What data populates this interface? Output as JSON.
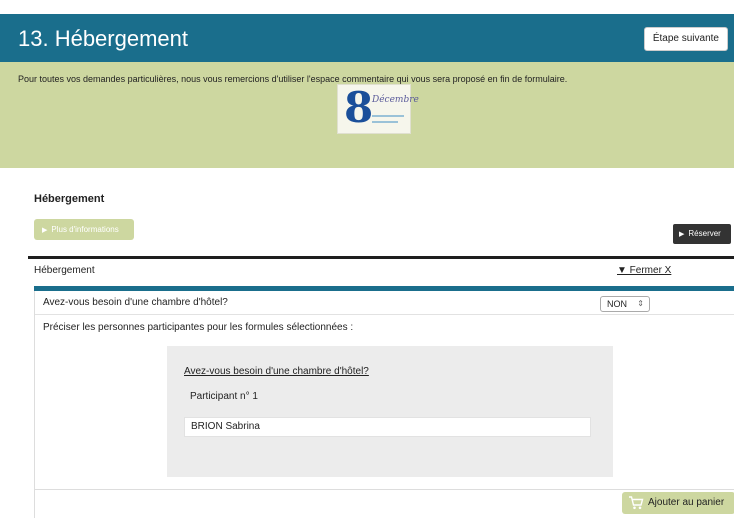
{
  "header": {
    "title": "13. Hébergement",
    "next_step_label": "Étape suivante"
  },
  "banner": {
    "text": "Pour toutes vos demandes particulières, nous vous remercions d'utiliser l'espace commentaire qui vous sera proposé en fin de formulaire.",
    "logo_digit": "8",
    "logo_script": "Décembre"
  },
  "section": {
    "heading": "Hébergement",
    "more_info_label": "Plus d'informations",
    "reserve_label": "Réserver"
  },
  "panel": {
    "title": "Hébergement",
    "close_label": "▼ Fermer  X",
    "question": "Avez-vous besoin d'une chambre d'hôtel?",
    "select_value": "NON",
    "participants_prompt": "Préciser les personnes participantes pour les formules sélectionnées :",
    "card": {
      "question": "Avez-vous besoin d'une chambre d'hôtel?",
      "participant_label": "Participant n° 1",
      "participant_name": "BRION Sabrina"
    },
    "cart_label": "Ajouter au panier"
  },
  "colors": {
    "header_bg": "#1a6e8c",
    "banner_bg": "#cdd7a0",
    "dark_button": "#333333"
  },
  "icons": [
    "play-triangle-icon",
    "chevron-updown-icon",
    "cart-icon"
  ]
}
